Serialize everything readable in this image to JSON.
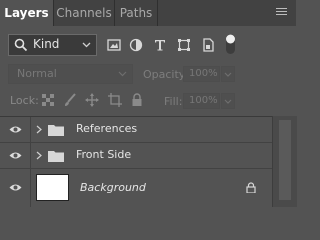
{
  "tabs": [
    {
      "label": "Layers",
      "active": true
    },
    {
      "label": "Channels",
      "active": false
    },
    {
      "label": "Paths",
      "active": false
    }
  ],
  "filter": {
    "kind_label": "Kind"
  },
  "blend": {
    "mode": "Normal",
    "opacity_label": "Opacity:",
    "opacity_value": "100%"
  },
  "lock": {
    "label": "Lock:",
    "fill_label": "Fill:",
    "fill_value": "100%"
  },
  "layers": [
    {
      "name": "References",
      "type": "group",
      "visible": true
    },
    {
      "name": "Front Side",
      "type": "group",
      "visible": true
    },
    {
      "name": "Background",
      "type": "background",
      "visible": true,
      "locked": true
    }
  ],
  "colors": {
    "panel": "#535353",
    "tabbar": "#424242",
    "text": "#e6e6e6"
  }
}
